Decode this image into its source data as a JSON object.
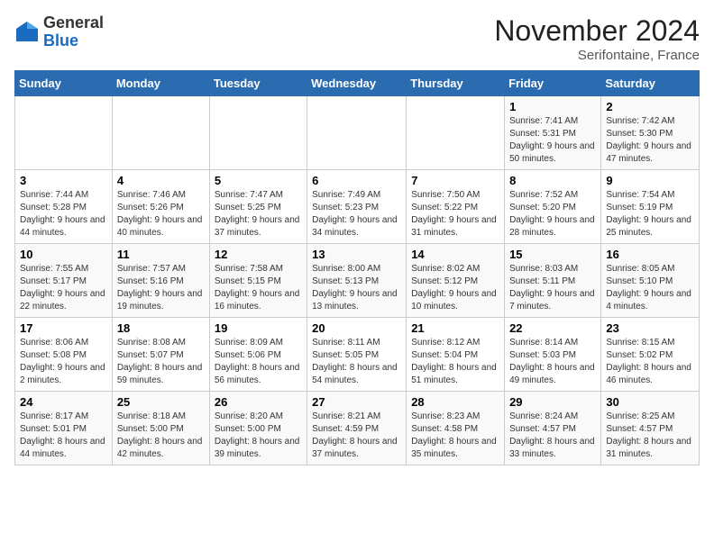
{
  "header": {
    "logo_general": "General",
    "logo_blue": "Blue",
    "month_title": "November 2024",
    "location": "Serifontaine, France"
  },
  "weekdays": [
    "Sunday",
    "Monday",
    "Tuesday",
    "Wednesday",
    "Thursday",
    "Friday",
    "Saturday"
  ],
  "weeks": [
    [
      {
        "day": "",
        "info": ""
      },
      {
        "day": "",
        "info": ""
      },
      {
        "day": "",
        "info": ""
      },
      {
        "day": "",
        "info": ""
      },
      {
        "day": "",
        "info": ""
      },
      {
        "day": "1",
        "info": "Sunrise: 7:41 AM\nSunset: 5:31 PM\nDaylight: 9 hours and 50 minutes."
      },
      {
        "day": "2",
        "info": "Sunrise: 7:42 AM\nSunset: 5:30 PM\nDaylight: 9 hours and 47 minutes."
      }
    ],
    [
      {
        "day": "3",
        "info": "Sunrise: 7:44 AM\nSunset: 5:28 PM\nDaylight: 9 hours and 44 minutes."
      },
      {
        "day": "4",
        "info": "Sunrise: 7:46 AM\nSunset: 5:26 PM\nDaylight: 9 hours and 40 minutes."
      },
      {
        "day": "5",
        "info": "Sunrise: 7:47 AM\nSunset: 5:25 PM\nDaylight: 9 hours and 37 minutes."
      },
      {
        "day": "6",
        "info": "Sunrise: 7:49 AM\nSunset: 5:23 PM\nDaylight: 9 hours and 34 minutes."
      },
      {
        "day": "7",
        "info": "Sunrise: 7:50 AM\nSunset: 5:22 PM\nDaylight: 9 hours and 31 minutes."
      },
      {
        "day": "8",
        "info": "Sunrise: 7:52 AM\nSunset: 5:20 PM\nDaylight: 9 hours and 28 minutes."
      },
      {
        "day": "9",
        "info": "Sunrise: 7:54 AM\nSunset: 5:19 PM\nDaylight: 9 hours and 25 minutes."
      }
    ],
    [
      {
        "day": "10",
        "info": "Sunrise: 7:55 AM\nSunset: 5:17 PM\nDaylight: 9 hours and 22 minutes."
      },
      {
        "day": "11",
        "info": "Sunrise: 7:57 AM\nSunset: 5:16 PM\nDaylight: 9 hours and 19 minutes."
      },
      {
        "day": "12",
        "info": "Sunrise: 7:58 AM\nSunset: 5:15 PM\nDaylight: 9 hours and 16 minutes."
      },
      {
        "day": "13",
        "info": "Sunrise: 8:00 AM\nSunset: 5:13 PM\nDaylight: 9 hours and 13 minutes."
      },
      {
        "day": "14",
        "info": "Sunrise: 8:02 AM\nSunset: 5:12 PM\nDaylight: 9 hours and 10 minutes."
      },
      {
        "day": "15",
        "info": "Sunrise: 8:03 AM\nSunset: 5:11 PM\nDaylight: 9 hours and 7 minutes."
      },
      {
        "day": "16",
        "info": "Sunrise: 8:05 AM\nSunset: 5:10 PM\nDaylight: 9 hours and 4 minutes."
      }
    ],
    [
      {
        "day": "17",
        "info": "Sunrise: 8:06 AM\nSunset: 5:08 PM\nDaylight: 9 hours and 2 minutes."
      },
      {
        "day": "18",
        "info": "Sunrise: 8:08 AM\nSunset: 5:07 PM\nDaylight: 8 hours and 59 minutes."
      },
      {
        "day": "19",
        "info": "Sunrise: 8:09 AM\nSunset: 5:06 PM\nDaylight: 8 hours and 56 minutes."
      },
      {
        "day": "20",
        "info": "Sunrise: 8:11 AM\nSunset: 5:05 PM\nDaylight: 8 hours and 54 minutes."
      },
      {
        "day": "21",
        "info": "Sunrise: 8:12 AM\nSunset: 5:04 PM\nDaylight: 8 hours and 51 minutes."
      },
      {
        "day": "22",
        "info": "Sunrise: 8:14 AM\nSunset: 5:03 PM\nDaylight: 8 hours and 49 minutes."
      },
      {
        "day": "23",
        "info": "Sunrise: 8:15 AM\nSunset: 5:02 PM\nDaylight: 8 hours and 46 minutes."
      }
    ],
    [
      {
        "day": "24",
        "info": "Sunrise: 8:17 AM\nSunset: 5:01 PM\nDaylight: 8 hours and 44 minutes."
      },
      {
        "day": "25",
        "info": "Sunrise: 8:18 AM\nSunset: 5:00 PM\nDaylight: 8 hours and 42 minutes."
      },
      {
        "day": "26",
        "info": "Sunrise: 8:20 AM\nSunset: 5:00 PM\nDaylight: 8 hours and 39 minutes."
      },
      {
        "day": "27",
        "info": "Sunrise: 8:21 AM\nSunset: 4:59 PM\nDaylight: 8 hours and 37 minutes."
      },
      {
        "day": "28",
        "info": "Sunrise: 8:23 AM\nSunset: 4:58 PM\nDaylight: 8 hours and 35 minutes."
      },
      {
        "day": "29",
        "info": "Sunrise: 8:24 AM\nSunset: 4:57 PM\nDaylight: 8 hours and 33 minutes."
      },
      {
        "day": "30",
        "info": "Sunrise: 8:25 AM\nSunset: 4:57 PM\nDaylight: 8 hours and 31 minutes."
      }
    ]
  ]
}
